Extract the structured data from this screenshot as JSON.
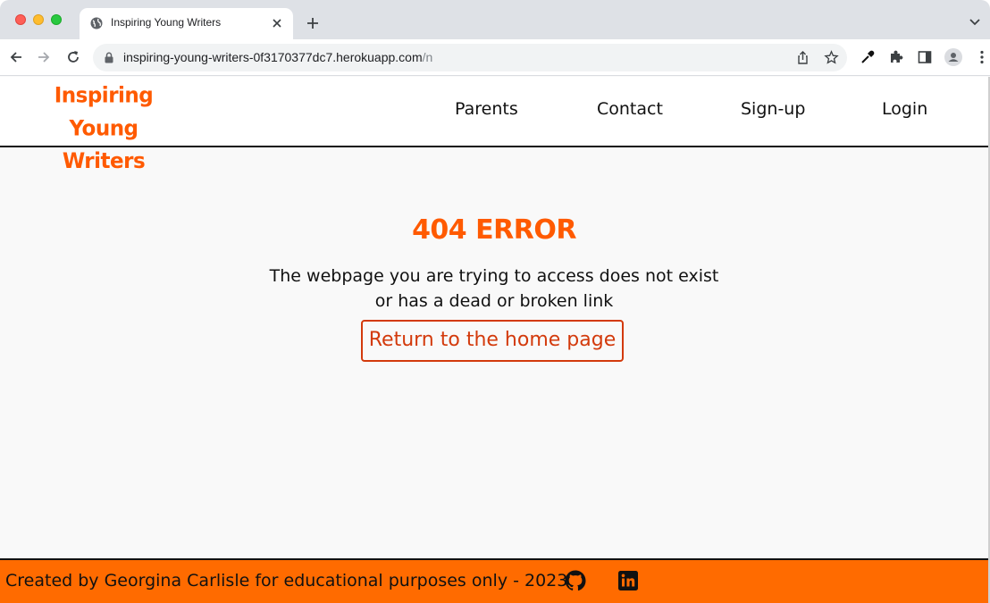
{
  "browser": {
    "tab_title": "Inspiring Young Writers",
    "url_domain": "inspiring-young-writers-0f3170377dc7.herokuapp.com",
    "url_path": "/n",
    "icons": [
      "globe-icon",
      "close-icon",
      "plus-icon",
      "chevron-down-icon",
      "back-arrow-icon",
      "forward-arrow-icon",
      "reload-icon",
      "lock-icon",
      "share-icon",
      "star-icon",
      "eyedropper-icon",
      "puzzle-icon",
      "side-panel-icon",
      "profile-icon",
      "kebab-menu-icon"
    ]
  },
  "site": {
    "logo_line1": "Inspiring Young",
    "logo_line2": "Writers",
    "nav": {
      "parents": "Parents",
      "contact": "Contact",
      "signup": "Sign-up",
      "login": "Login"
    }
  },
  "error": {
    "title": "404 ERROR",
    "message_line1": "The webpage you are trying to access does not exist",
    "message_line2": "or has a dead or broken link",
    "button_label": "Return to the home page"
  },
  "footer": {
    "text": "Created by Georgina Carlisle for educational purposes only - 2023",
    "icons": [
      "github-icon",
      "linkedin-icon"
    ]
  },
  "colors": {
    "brand_orange": "#ff5a00",
    "footer_orange": "#ff6b00",
    "button_border": "#d33a0c"
  }
}
